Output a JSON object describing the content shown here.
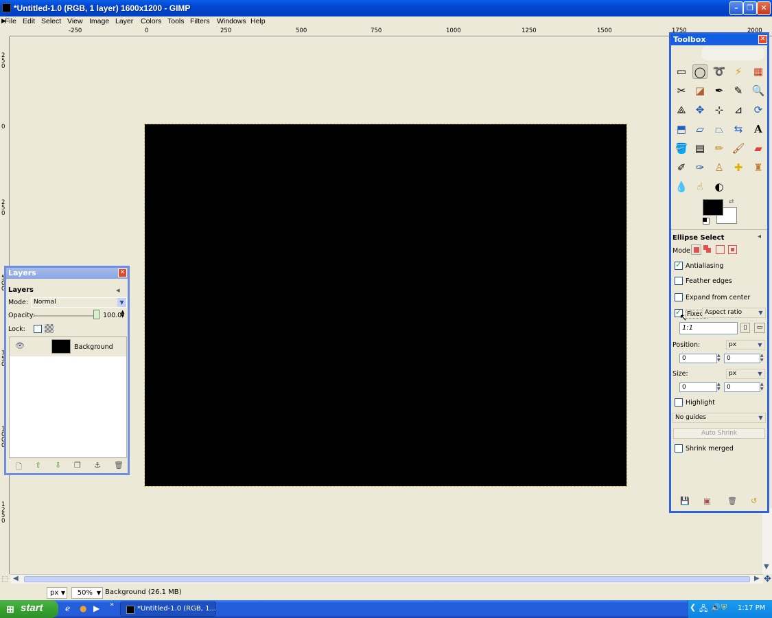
{
  "window": {
    "title": "*Untitled-1.0 (RGB, 1 layer) 1600x1200 - GIMP"
  },
  "menu": [
    "File",
    "Edit",
    "Select",
    "View",
    "Image",
    "Layer",
    "Colors",
    "Tools",
    "Filters",
    "Windows",
    "Help"
  ],
  "ruler": {
    "h_ticks": [
      "-250",
      "0",
      "250",
      "500",
      "750",
      "1000",
      "1250",
      "1500",
      "1750",
      "2000"
    ],
    "v_ticks": [
      "250",
      "0",
      "250",
      "500",
      "750",
      "1000",
      "1250"
    ]
  },
  "statusbar": {
    "unit": "px",
    "zoom": "50%",
    "message": "Background (26.1 MB)"
  },
  "layers_dialog": {
    "title": "Layers",
    "tab": "Layers",
    "mode_label": "Mode:",
    "mode_value": "Normal",
    "opacity_label": "Opacity:",
    "opacity_value": "100.0",
    "lock_label": "Lock:",
    "layers": [
      {
        "name": "Background",
        "visible": true
      }
    ]
  },
  "toolbox": {
    "title": "Toolbox",
    "tool_options_title": "Ellipse Select",
    "mode_label": "Mode:",
    "antialiasing": {
      "label": "Antialiasing",
      "checked": true
    },
    "feather": {
      "label": "Feather edges",
      "checked": false
    },
    "expand": {
      "label": "Expand from center",
      "checked": false
    },
    "fixed": {
      "label": "Fixed:",
      "checked": true,
      "value": "Aspect ratio"
    },
    "ratio": "1:1",
    "position": {
      "label": "Position:",
      "unit": "px",
      "x": "0",
      "y": "0"
    },
    "size": {
      "label": "Size:",
      "unit": "px",
      "w": "0",
      "h": "0"
    },
    "highlight": {
      "label": "Highlight",
      "checked": false
    },
    "guides": "No guides",
    "auto_shrink": "Auto Shrink",
    "shrink_merged": {
      "label": "Shrink merged",
      "checked": false
    }
  },
  "taskbar": {
    "start": "start",
    "task": "*Untitled-1.0 (RGB, 1...",
    "clock": "1:17 PM"
  }
}
